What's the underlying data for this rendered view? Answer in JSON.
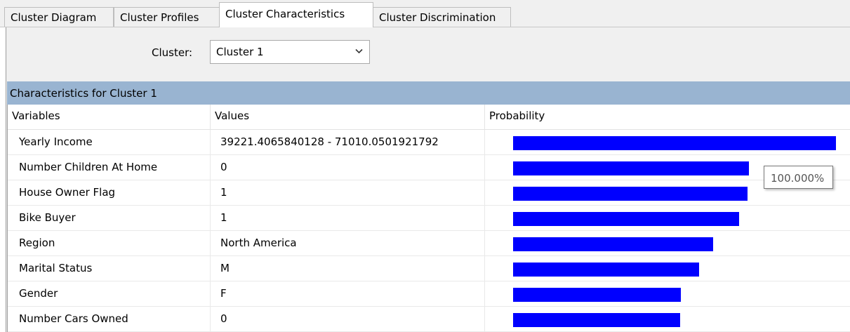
{
  "tabs": [
    {
      "label": "Cluster Diagram",
      "active": false
    },
    {
      "label": "Cluster Profiles",
      "active": false
    },
    {
      "label": "Cluster Characteristics",
      "active": true
    },
    {
      "label": "Cluster Discrimination",
      "active": false
    }
  ],
  "cluster_selector": {
    "label": "Cluster:",
    "selected": "Cluster 1"
  },
  "characteristics": {
    "header": "Characteristics for Cluster 1",
    "columns": [
      "Variables",
      "Values",
      "Probability"
    ],
    "bar_color": "#0000ff",
    "rows": [
      {
        "variable": "Yearly Income",
        "value": "39221.4065840128 - 71010.0501921792",
        "probability": 1.0
      },
      {
        "variable": "Number Children At Home",
        "value": "0",
        "probability": 0.73
      },
      {
        "variable": "House Owner Flag",
        "value": "1",
        "probability": 0.727
      },
      {
        "variable": "Bike Buyer",
        "value": "1",
        "probability": 0.7
      },
      {
        "variable": "Region",
        "value": "North America",
        "probability": 0.62
      },
      {
        "variable": "Marital Status",
        "value": "M",
        "probability": 0.575
      },
      {
        "variable": "Gender",
        "value": "F",
        "probability": 0.52
      },
      {
        "variable": "Number Cars Owned",
        "value": "0",
        "probability": 0.517
      }
    ]
  },
  "tooltip": {
    "text": "100.000%"
  }
}
